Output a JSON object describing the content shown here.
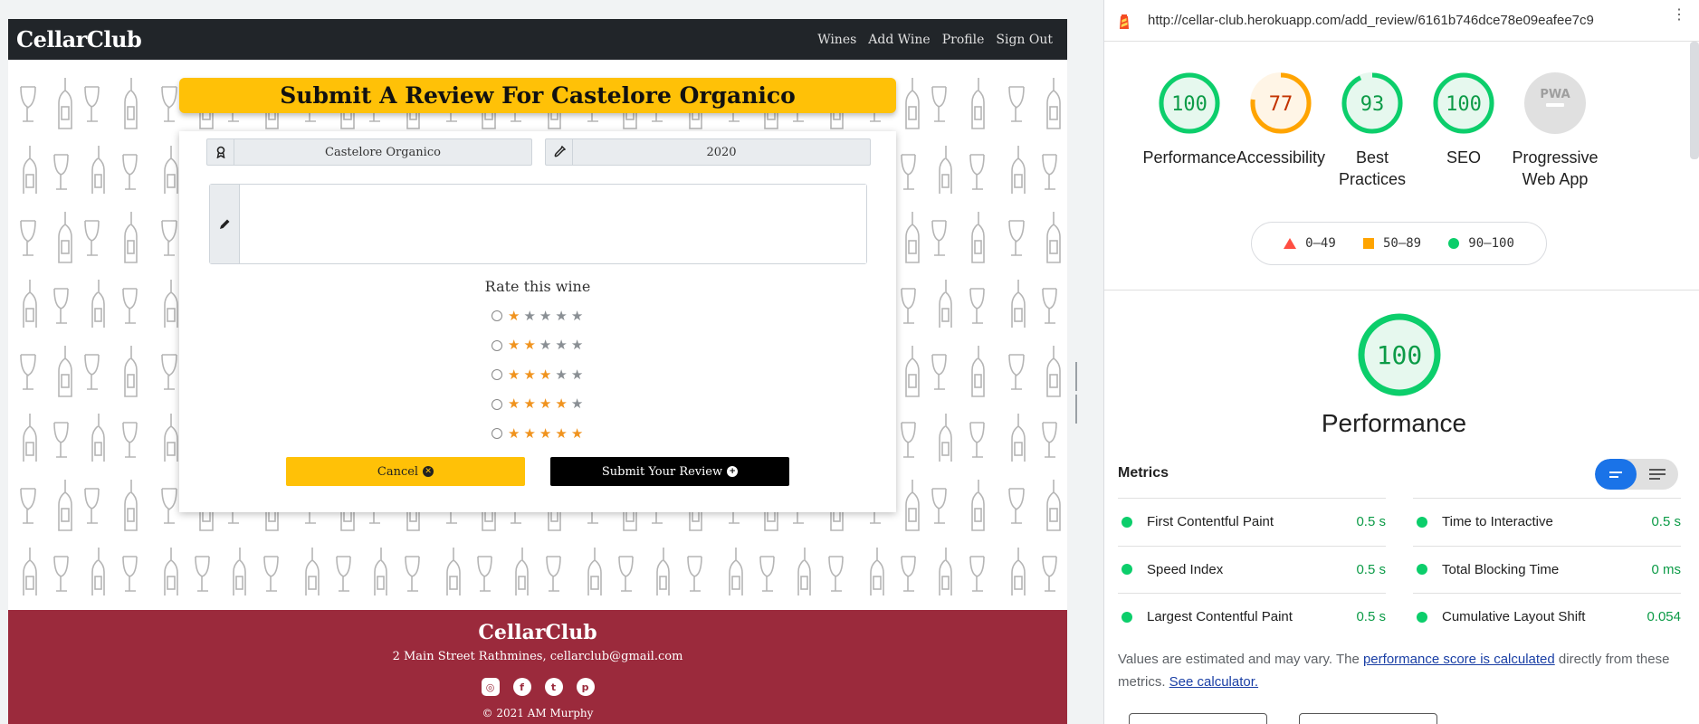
{
  "site": {
    "brand": "CellarClub",
    "nav": [
      "Wines",
      "Add Wine",
      "Profile",
      "Sign Out"
    ],
    "title": "Submit A Review For Castelore Organico",
    "wine_name": "Castelore Organico",
    "vintage": "2020",
    "review_placeholder": "",
    "rate_label": "Rate this wine",
    "ratings": [
      1,
      2,
      3,
      4,
      5
    ],
    "cancel_label": "Cancel",
    "submit_label": "Submit Your Review",
    "footer": {
      "brand": "CellarClub",
      "address": "2 Main Street Rathmines,  cellarclub@gmail.com",
      "copyright": "© 2021 AM Murphy",
      "socials": [
        "instagram-icon",
        "facebook-icon",
        "twitter-icon",
        "pinterest-icon"
      ]
    }
  },
  "lighthouse": {
    "url": "http://cellar-club.herokuapp.com/add_review/6161b746dce78e09eafee7c9",
    "scores": [
      {
        "label": "Performance",
        "score": "100",
        "value": 100,
        "color": "#0cce6b",
        "fill": "#e6f8ee",
        "text": "#0c9b47"
      },
      {
        "label": "Accessibility",
        "score": "77",
        "value": 77,
        "color": "#ffa400",
        "fill": "#fff5e6",
        "text": "#c33300"
      },
      {
        "label": "Best Practices",
        "score": "93",
        "value": 93,
        "color": "#0cce6b",
        "fill": "#e6f8ee",
        "text": "#0c9b47"
      },
      {
        "label": "SEO",
        "score": "100",
        "value": 100,
        "color": "#0cce6b",
        "fill": "#e6f8ee",
        "text": "#0c9b47"
      },
      {
        "label": "Progressive Web App",
        "score": "PWA",
        "value": 0,
        "color": "#cfcfcf",
        "fill": "#e0e0e0",
        "text": "#9e9e9e"
      }
    ],
    "legend": [
      "0–49",
      "50–89",
      "90–100"
    ],
    "big_score": "100",
    "big_label": "Performance",
    "metrics_title": "Metrics",
    "metrics": [
      {
        "name": "First Contentful Paint",
        "value": "0.5 s"
      },
      {
        "name": "Time to Interactive",
        "value": "0.5 s"
      },
      {
        "name": "Speed Index",
        "value": "0.5 s"
      },
      {
        "name": "Total Blocking Time",
        "value": "0 ms"
      },
      {
        "name": "Largest Contentful Paint",
        "value": "0.5 s"
      },
      {
        "name": "Cumulative Layout Shift",
        "value": "0.054"
      }
    ],
    "note_pre": "Values are estimated and may vary. The ",
    "note_link1": "performance score is calculated",
    "note_mid": " directly from these metrics. ",
    "note_link2": "See calculator."
  }
}
